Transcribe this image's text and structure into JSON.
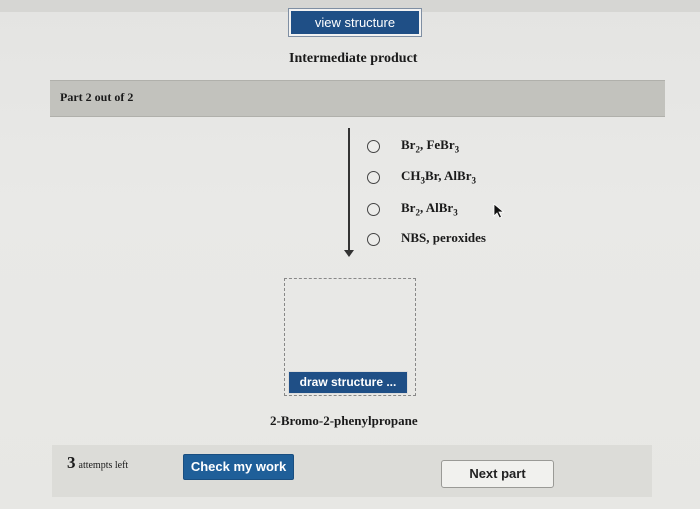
{
  "header": {
    "view_button": "view structure",
    "intermediate_label": "Intermediate product"
  },
  "part": {
    "label": "Part 2 out of 2"
  },
  "reagent_options": [
    {
      "html": "Br<sub>2</sub>, FeBr<sub>3</sub>",
      "text": "Br2, FeBr3"
    },
    {
      "html": "CH<sub>3</sub>Br, AlBr<sub>3</sub>",
      "text": "CH3Br, AlBr3"
    },
    {
      "html": "Br<sub>2</sub>, AlBr<sub>3</sub>",
      "text": "Br2, AlBr3"
    },
    {
      "html": "NBS, peroxides",
      "text": "NBS, peroxides"
    }
  ],
  "draw": {
    "button": "draw structure ..."
  },
  "product": {
    "label": "2-Bromo-2-phenylpropane"
  },
  "footer": {
    "attempts_number": "3",
    "attempts_text": "attempts left",
    "check_button": "Check my work",
    "next_button": "Next part"
  },
  "colors": {
    "button_blue": "#1f4f86",
    "part_bar": "#c2c2bd"
  }
}
